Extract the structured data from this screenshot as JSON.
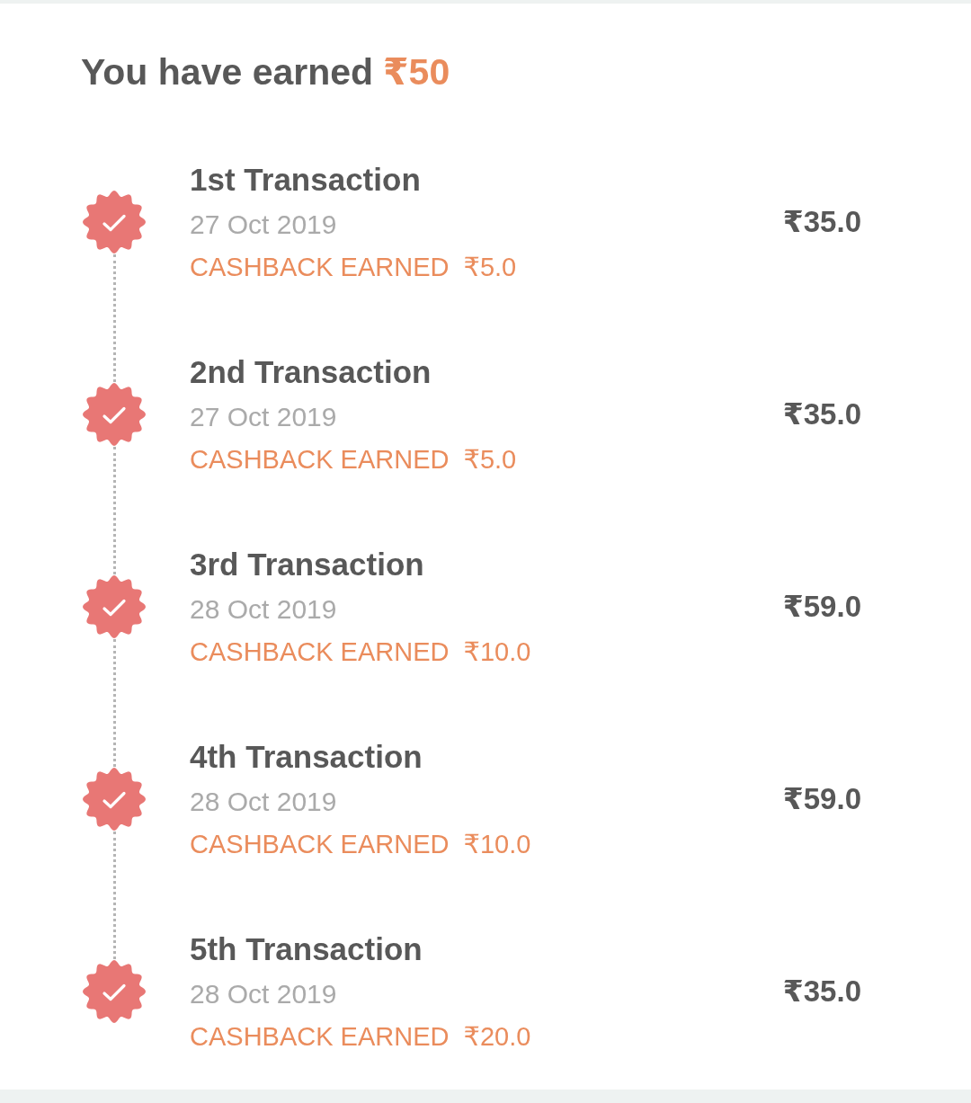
{
  "header": {
    "text": "You have earned",
    "total": "₹50"
  },
  "transactions": [
    {
      "title": "1st Transaction",
      "date": "27 Oct 2019",
      "cashback_label": "CASHBACK EARNED",
      "cashback_amount": "₹5.0",
      "amount": "₹35.0",
      "completed": true
    },
    {
      "title": "2nd Transaction",
      "date": "27 Oct 2019",
      "cashback_label": "CASHBACK EARNED",
      "cashback_amount": "₹5.0",
      "amount": "₹35.0",
      "completed": true
    },
    {
      "title": "3rd Transaction",
      "date": "28 Oct 2019",
      "cashback_label": "CASHBACK EARNED",
      "cashback_amount": "₹10.0",
      "amount": "₹59.0",
      "completed": true
    },
    {
      "title": "4th Transaction",
      "date": "28 Oct 2019",
      "cashback_label": "CASHBACK EARNED",
      "cashback_amount": "₹10.0",
      "amount": "₹59.0",
      "completed": true
    },
    {
      "title": "5th Transaction",
      "date": "28 Oct 2019",
      "cashback_label": "CASHBACK EARNED",
      "cashback_amount": "₹20.0",
      "amount": "₹35.0",
      "completed": true
    }
  ]
}
